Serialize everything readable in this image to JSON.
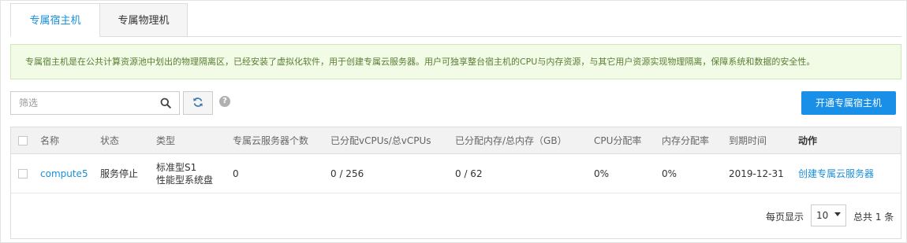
{
  "tabs": [
    {
      "label": "专属宿主机",
      "active": true
    },
    {
      "label": "专属物理机",
      "active": false
    }
  ],
  "banner": {
    "text": "专属宿主机是在公共计算资源池中划出的物理隔离区，已经安装了虚拟化软件，用于创建专属云服务器。用户可独享整台宿主机的CPU与内存资源，与其它用户资源实现物理隔离，保障系统和数据的安全性。"
  },
  "toolbar": {
    "filter_placeholder": "筛选",
    "filter_value": "",
    "search_icon": "search-icon",
    "refresh_icon": "refresh-icon",
    "help_icon": "help-icon",
    "help_glyph": "?",
    "create_button": "开通专属宿主机"
  },
  "table": {
    "headers": {
      "name": "名称",
      "status": "状态",
      "type": "类型",
      "ecs_count": "专属云服务器个数",
      "vcpus": "已分配vCPUs/总vCPUs",
      "memory": "已分配内存/总内存（GB）",
      "cpu_rate": "CPU分配率",
      "mem_rate": "内存分配率",
      "expiry": "到期时间",
      "action": "动作"
    },
    "rows": [
      {
        "name": "compute5",
        "status": "服务停止",
        "type_line1": "标准型S1",
        "type_line2": "性能型系统盘",
        "ecs_count": "0",
        "vcpus": "0 / 256",
        "memory": "0 / 62",
        "cpu_rate": "0%",
        "mem_rate": "0%",
        "expiry": "2019-12-31",
        "action": "创建专属云服务器"
      }
    ]
  },
  "pagination": {
    "per_page_label": "每页显示",
    "per_page_value": "10",
    "total_text": "总共 1 条"
  },
  "colors": {
    "accent": "#1a8fe8",
    "link": "#1a8fd8",
    "banner_bg": "#f1fbe6",
    "banner_text": "#5a7d33"
  }
}
